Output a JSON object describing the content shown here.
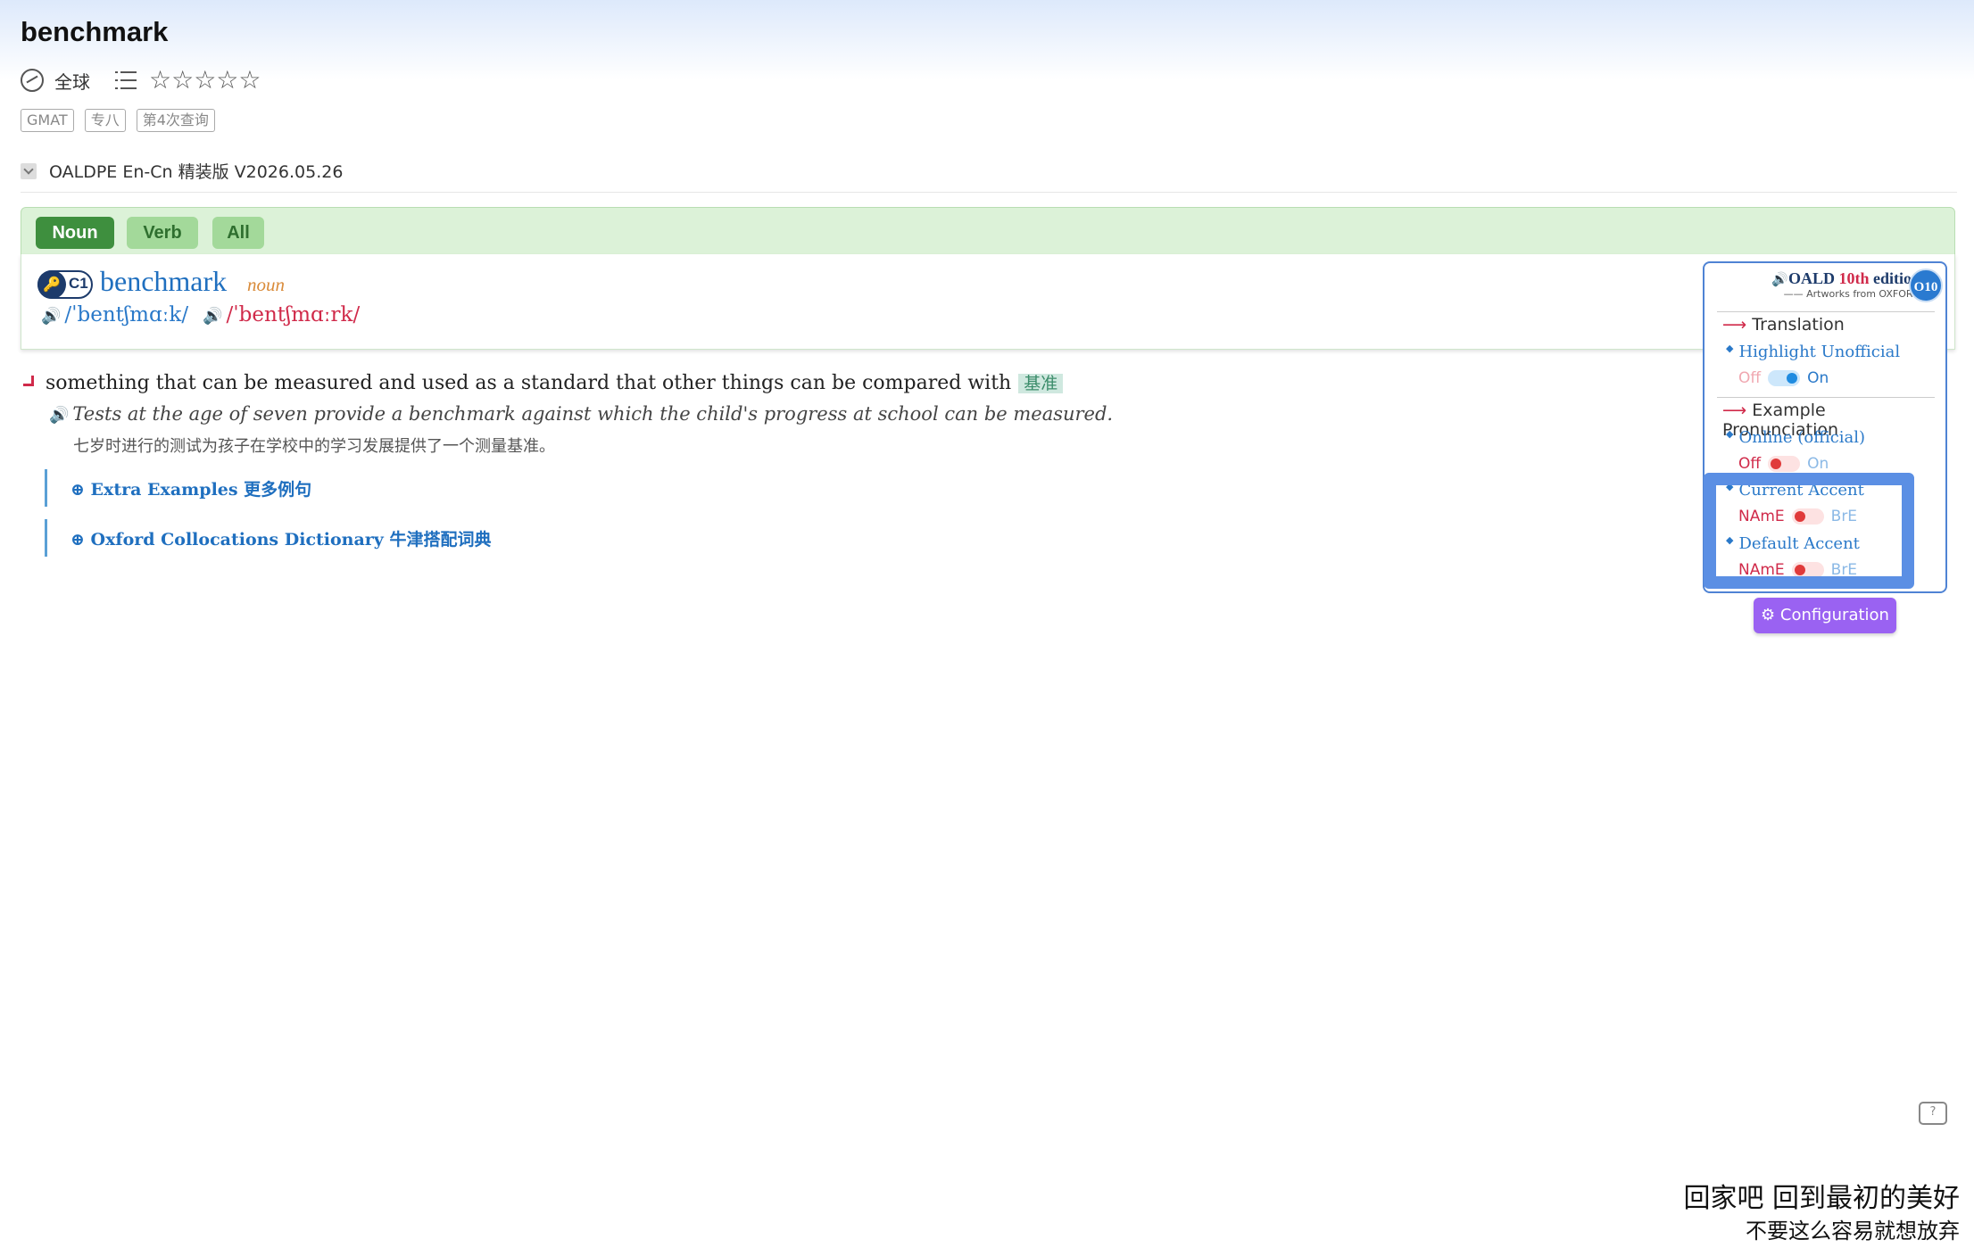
{
  "header": {
    "word": "benchmark",
    "region": "全球",
    "stars": "☆☆☆☆☆",
    "tags": [
      "GMAT",
      "专八",
      "第4次查询"
    ]
  },
  "dictionary": {
    "name": "OALDPE En-Cn 精装版 V2026.05.26"
  },
  "pos_tabs": [
    "Noun",
    "Verb",
    "All"
  ],
  "entry": {
    "level_key": "🔑",
    "level": "C1",
    "headword": "benchmark",
    "pos": "noun",
    "pron_br": "/ˈbentʃmɑːk/",
    "pron_am": "/ˈbentʃmɑːrk/",
    "speaker": "🔊"
  },
  "sense": {
    "definition": "something that can be measured and used as a standard that other things can be compared with",
    "definition_cn": "基准",
    "example": "Tests at the age of seven provide a benchmark against which the child's progress at school can be measured.",
    "example_cn": "七岁时进行的测试为孩子在学校中的学习发展提供了一个测量基准。",
    "extra_examples": "⊕ Extra Examples 更多例句",
    "collocations": "⊕ Oxford Collocations Dictionary 牛津搭配词典"
  },
  "popup": {
    "title_prefix": "OALD ",
    "title_edition": "10th",
    "title_suffix": " edition",
    "subtitle": "—— Artworks from OXFORD",
    "badge": "O10",
    "translation": "Translation",
    "highlight_unofficial": "Highlight Unofficial",
    "off": "Off",
    "on": "On",
    "example_pronunciation": "Example Pronunciation",
    "online_official": "Online (official)",
    "current_accent": "Current Accent",
    "default_accent": "Default Accent",
    "name": "NAmE",
    "bre": "BrE",
    "highlight_unofficial_state": "on",
    "online_official_state": "off",
    "current_accent_state": "NAmE",
    "default_accent_state": "NAmE"
  },
  "configuration_button": "⚙ Configuration",
  "chat_icon": "?",
  "overlay": {
    "line1": "回家吧 回到最初的美好",
    "line2": "不要这么容易就想放弃"
  },
  "colors": {
    "accent_blue": "#1f6fbf",
    "pos_active": "#3e8f3e",
    "config_purple": "#9a62f2",
    "highlight_border": "#5b8fe4"
  }
}
